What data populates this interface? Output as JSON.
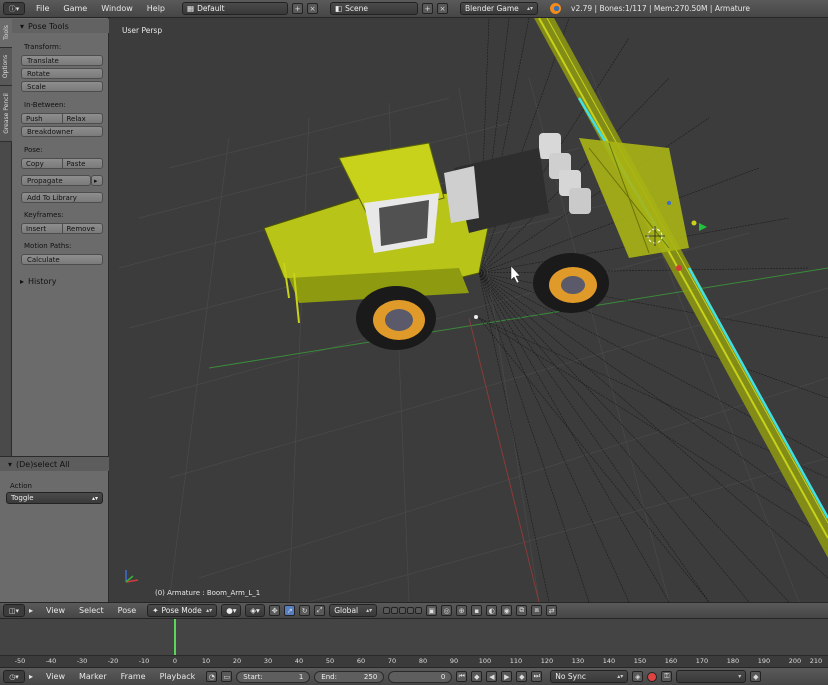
{
  "top_header": {
    "menus": [
      "File",
      "Game",
      "Window",
      "Help"
    ],
    "screen_layout": "Default",
    "scene": "Scene",
    "render_engine": "Blender Game",
    "info": "v2.79 | Bones:1/117 | Mem:270.50M | Armature"
  },
  "shelf": {
    "tabs": [
      "Tools",
      "Options",
      "Grease Pencil"
    ],
    "panel_title": "Pose Tools",
    "sections": {
      "transform": "Transform:",
      "in_between": "In-Between:",
      "pose": "Pose:",
      "keyframes": "Keyframes:",
      "motion_paths": "Motion Paths:"
    },
    "buttons": {
      "translate": "Translate",
      "rotate": "Rotate",
      "scale": "Scale",
      "push": "Push",
      "relax": "Relax",
      "breakdowner": "Breakdowner",
      "copy": "Copy",
      "paste": "Paste",
      "propagate": "Propagate",
      "add_to_library": "Add To Library",
      "insert": "Insert",
      "remove": "Remove",
      "calculate": "Calculate"
    },
    "history": "History"
  },
  "operator_panel": {
    "title": "(De)select All",
    "action_label": "Action",
    "action_value": "Toggle"
  },
  "viewport": {
    "view_name": "User Persp",
    "status": "(0) Armature : Boom_Arm_L_1"
  },
  "view_header": {
    "menus": [
      "View",
      "Select",
      "Pose"
    ],
    "mode": "Pose Mode",
    "orientation": "Global"
  },
  "timeline": {
    "ticks": [
      "-50",
      "-40",
      "-30",
      "-20",
      "-10",
      "0",
      "10",
      "20",
      "30",
      "40",
      "50",
      "60",
      "70",
      "80",
      "90",
      "100",
      "110",
      "120",
      "130",
      "140",
      "150",
      "160",
      "170",
      "180",
      "190",
      "200",
      "210"
    ],
    "current_frame": "0"
  },
  "timeline_header": {
    "menus": [
      "View",
      "Marker",
      "Frame",
      "Playback"
    ],
    "start_label": "Start:",
    "start_value": "1",
    "end_label": "End:",
    "end_value": "250",
    "frame_value": "0",
    "sync": "No Sync"
  },
  "colors": {
    "background": "#3d3d3d",
    "panel": "#6b6b6b",
    "tractor": "#c8d21a",
    "wheel": "#e09a2a",
    "axis_x": "#b43c3c",
    "axis_y": "#3a8a3a",
    "selected_bone": "#40e0e8"
  }
}
